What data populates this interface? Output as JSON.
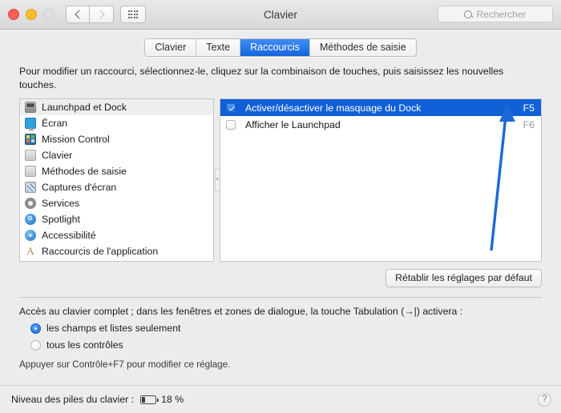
{
  "window": {
    "title": "Clavier",
    "traffic_lights": [
      "close",
      "minimize",
      "zoom"
    ],
    "nav_back": "back-arrow",
    "nav_forward": "forward-arrow",
    "grid_button": "all-preferences-grid"
  },
  "search": {
    "placeholder": "Rechercher",
    "value": ""
  },
  "tabs": [
    {
      "label": "Clavier",
      "active": false
    },
    {
      "label": "Texte",
      "active": false
    },
    {
      "label": "Raccourcis",
      "active": true
    },
    {
      "label": "Méthodes de saisie",
      "active": false
    }
  ],
  "description": "Pour modifier un raccourci, sélectionnez-le, cliquez sur la combinaison de touches, puis saisissez les nouvelles touches.",
  "categories": [
    {
      "label": "Launchpad et Dock",
      "icon": "launchpad-dock-icon",
      "selected": true
    },
    {
      "label": "Écran",
      "icon": "display-icon",
      "selected": false
    },
    {
      "label": "Mission Control",
      "icon": "mission-control-icon",
      "selected": false
    },
    {
      "label": "Clavier",
      "icon": "keyboard-icon",
      "selected": false
    },
    {
      "label": "Méthodes de saisie",
      "icon": "input-sources-icon",
      "selected": false
    },
    {
      "label": "Captures d'écran",
      "icon": "screenshots-icon",
      "selected": false
    },
    {
      "label": "Services",
      "icon": "services-gear-icon",
      "selected": false
    },
    {
      "label": "Spotlight",
      "icon": "spotlight-icon",
      "selected": false
    },
    {
      "label": "Accessibilité",
      "icon": "accessibility-icon",
      "selected": false
    },
    {
      "label": "Raccourcis de l'application",
      "icon": "app-shortcuts-icon",
      "selected": false
    }
  ],
  "shortcuts": [
    {
      "label": "Activer/désactiver le masquage du Dock",
      "key": "F5",
      "checked": true,
      "selected": true
    },
    {
      "label": "Afficher le Launchpad",
      "key": "F6",
      "checked": false,
      "selected": false
    }
  ],
  "reset_button": "Rétablir les réglages par défaut",
  "full_keyboard_access": {
    "description": "Accès au clavier complet ; dans les fenêtres et zones de dialogue, la touche Tabulation (→|) activera :",
    "options": [
      {
        "label": "les champs et listes seulement",
        "selected": true
      },
      {
        "label": "tous les contrôles",
        "selected": false
      }
    ],
    "hint": "Appuyer sur Contrôle+F7 pour modifier ce réglage."
  },
  "status": {
    "battery_label": "Niveau des piles du clavier :",
    "battery_percent": "18 %",
    "battery_icon": "low-battery-icon",
    "help": "?"
  },
  "annotation": {
    "type": "arrow",
    "color": "#1b6ad6",
    "points_at": "F5"
  },
  "colors": {
    "selection_blue": "#1060d8",
    "tab_active_blue": "#2a7bea",
    "annotation_blue": "#1b6ad6"
  }
}
